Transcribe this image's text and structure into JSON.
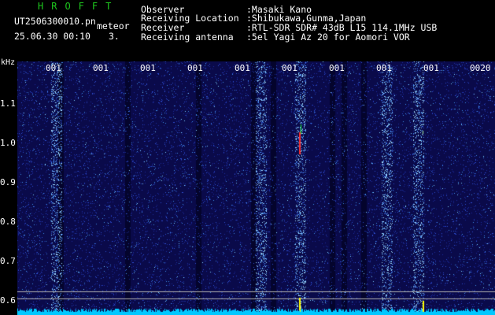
{
  "header": {
    "brand": "HROFFT",
    "filename": "UT2506300010.pn",
    "meteor_label": "meteor",
    "datetime": "25.06.30 00:10",
    "count": "3.",
    "info_labels": [
      "Observer",
      "Receiving Location",
      "Receiver",
      "Receiving antenna"
    ],
    "info_values": [
      ":Masaki Kano",
      ":Shibukawa,Gunma,Japan",
      ":RTL-SDR SDR# 43dB L15 114.1MHz USB",
      ":5el Yagi Az 20 for Aomori VOR"
    ]
  },
  "axis": {
    "unit": "kHz",
    "y_ticks": [
      "1.1",
      "1.0",
      "0.9",
      "0.8",
      "0.7",
      "0.6"
    ],
    "x_ticks": [
      "001",
      "001",
      "001",
      "001",
      "001",
      "001",
      "001",
      "001",
      "001",
      "0020"
    ]
  },
  "colors": {
    "background": "#0a0a4a",
    "brand": "#1ec81e",
    "noise_floor": "#00c8ff",
    "echo": "#ff3030",
    "marker": "#ffff00"
  }
}
